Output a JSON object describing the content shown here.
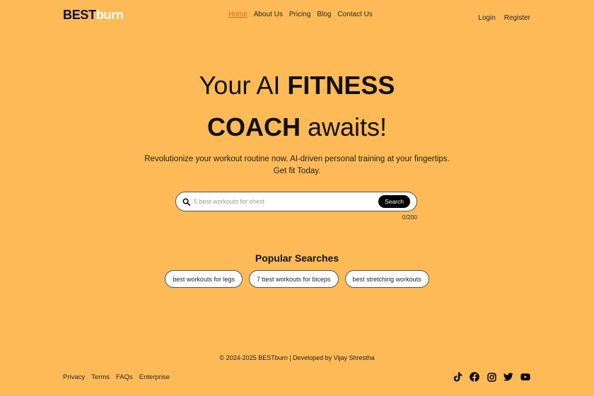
{
  "header": {
    "logo": {
      "part1": "BEST",
      "part2": "burn"
    },
    "nav": [
      {
        "label": "Home",
        "active": true
      },
      {
        "label": "About Us"
      },
      {
        "label": "Pricing"
      },
      {
        "label": "Blog"
      },
      {
        "label": "Contact Us"
      }
    ],
    "auth": {
      "login": "Login",
      "register": "Register"
    }
  },
  "hero": {
    "line1_regular": "Your AI ",
    "line1_bold": "FITNESS",
    "line2_bold": "COACH",
    "line2_regular": " awaits!",
    "subtitle_line1": "Revolutionize your workout routine now. AI-driven personal training at your fingertips.",
    "subtitle_line2": "Get fit Today."
  },
  "search": {
    "icon": "search-icon",
    "placeholder": "5 best workouts for chest",
    "value": "",
    "button_label": "Search",
    "counter": "0/200"
  },
  "popular": {
    "title": "Popular Searches",
    "items": [
      "best workouts for legs",
      "7 best workouts for biceps",
      "best stretching workouts"
    ]
  },
  "footer": {
    "copyright": "© 2024-2025 BESTburn | Developed by Vijay Shrestha",
    "links": [
      "Privacy",
      "Terms",
      "FAQs",
      "Enterprise"
    ],
    "socials": [
      "tiktok-icon",
      "facebook-icon",
      "instagram-icon",
      "twitter-icon",
      "youtube-icon"
    ]
  },
  "colors": {
    "background": "#FDBA57",
    "active_nav": "#D96A16",
    "logo_accent": "#FFFFFF"
  }
}
